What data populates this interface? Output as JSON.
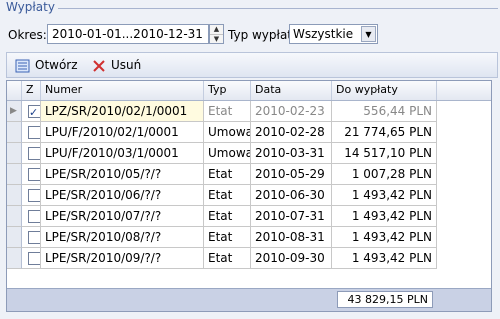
{
  "group_title": "Wypłaty",
  "filters": {
    "period_label": "Okres:",
    "period_value": "2010-01-01...2010-12-31",
    "type_label": "Typ wypłaty:",
    "type_value": "Wszystkie"
  },
  "toolbar": {
    "open_label": "Otwórz",
    "delete_label": "Usuń"
  },
  "columns": [
    "Z",
    "Numer",
    "Typ",
    "Data",
    "Do wypłaty"
  ],
  "rows": [
    {
      "checked": true,
      "numer": "LPZ/SR/2010/02/1/0001",
      "typ": "Etat",
      "data": "2010-02-23",
      "kwota": "556,44 PLN"
    },
    {
      "checked": false,
      "numer": "LPU/F/2010/02/1/0001",
      "typ": "Umowa",
      "data": "2010-02-28",
      "kwota": "21 774,65 PLN"
    },
    {
      "checked": false,
      "numer": "LPU/F/2010/03/1/0001",
      "typ": "Umowa",
      "data": "2010-03-31",
      "kwota": "14 517,10 PLN"
    },
    {
      "checked": false,
      "numer": "LPE/SR/2010/05/?/?",
      "typ": "Etat",
      "data": "2010-05-29",
      "kwota": "1 007,28 PLN"
    },
    {
      "checked": false,
      "numer": "LPE/SR/2010/06/?/?",
      "typ": "Etat",
      "data": "2010-06-30",
      "kwota": "1 493,42 PLN"
    },
    {
      "checked": false,
      "numer": "LPE/SR/2010/07/?/?",
      "typ": "Etat",
      "data": "2010-07-31",
      "kwota": "1 493,42 PLN"
    },
    {
      "checked": false,
      "numer": "LPE/SR/2010/08/?/?",
      "typ": "Etat",
      "data": "2010-08-31",
      "kwota": "1 493,42 PLN"
    },
    {
      "checked": false,
      "numer": "LPE/SR/2010/09/?/?",
      "typ": "Etat",
      "data": "2010-09-30",
      "kwota": "1 493,42 PLN"
    }
  ],
  "total": "43 829,15 PLN"
}
